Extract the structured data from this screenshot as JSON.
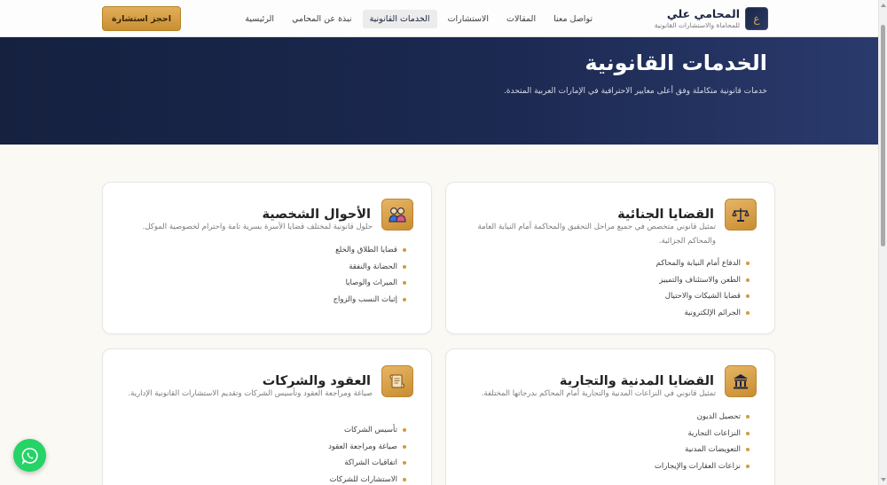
{
  "brand": {
    "logo_letter": "ع",
    "name": "المحامي علي",
    "tagline": "للمحاماة والاستشارات القانونية"
  },
  "nav": {
    "items": [
      {
        "label": "الرئيسية",
        "active": false
      },
      {
        "label": "نبذة عن المحامي",
        "active": false
      },
      {
        "label": "الخدمات القانونية",
        "active": true
      },
      {
        "label": "الاستشارات",
        "active": false
      },
      {
        "label": "المقالات",
        "active": false
      },
      {
        "label": "تواصل معنا",
        "active": false
      }
    ],
    "cta_label": "احجز استشارة"
  },
  "hero": {
    "title": "الخدمات القانونية",
    "subtitle": "خدمات قانونية متكاملة وفق أعلى معايير الاحترافية في الإمارات العربية المتحدة."
  },
  "cards": [
    {
      "icon": "scales-icon",
      "title": "القضايا الجنائية",
      "description": "تمثيل قانوني متخصص في جميع مراحل التحقيق والمحاكمة أمام النيابة العامة والمحاكم الجزائية.",
      "items": [
        "الدفاع أمام النيابة والمحاكم",
        "الطعن والاستئناف والتمييز",
        "قضايا الشيكات والاحتيال",
        "الجرائم الإلكترونية"
      ]
    },
    {
      "icon": "family-icon",
      "title": "الأحوال الشخصية",
      "description": "حلول قانونية لمختلف قضايا الأسرة بسرية تامة واحترام لخصوصية الموكل.",
      "items": [
        "قضايا الطلاق والخلع",
        "الحضانة والنفقة",
        "الميراث والوصايا",
        "إثبات النسب والزواج"
      ]
    },
    {
      "icon": "bank-icon",
      "title": "القضايا المدنية والتجارية",
      "description": "تمثيل قانوني في النزاعات المدنية والتجارية أمام المحاكم بدرجاتها المختلفة.",
      "items": [
        "تحصيل الديون",
        "النزاعات التجارية",
        "التعويضات المدنية",
        "نزاعات العقارات والإيجارات"
      ]
    },
    {
      "icon": "scroll-icon",
      "title": "العقود والشركات",
      "description": "صياغة ومراجعة العقود وتأسيس الشركات وتقديم الاستشارات القانونية الإدارية.",
      "items": [
        "تأسيس الشركات",
        "صياغة ومراجعة العقود",
        "اتفاقيات الشراكة",
        "الاستشارات للشركات"
      ]
    }
  ],
  "colors": {
    "navy": "#15213f",
    "gold": "#d29a3f",
    "whatsapp": "#25d366"
  }
}
